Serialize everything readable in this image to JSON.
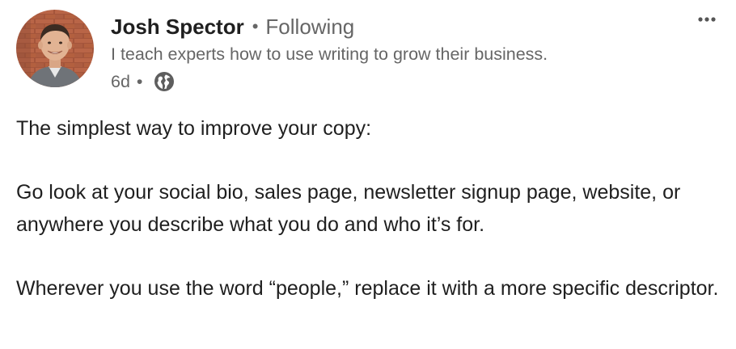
{
  "author": {
    "name": "Josh Spector",
    "follow_status": "Following",
    "headline": "I teach experts how to use writing to grow their business.",
    "separator": "•"
  },
  "meta": {
    "time_ago": "6d",
    "separator": "•",
    "visibility_icon": "globe-icon"
  },
  "menu": {
    "icon": "more-horizontal-icon"
  },
  "post": {
    "paragraphs": [
      "The simplest way to improve your copy:",
      "Go look at your social bio, sales page, newsletter signup page, website, or anywhere you describe what you do and who it’s for.",
      "Wherever you use the word “people,” replace it with a more specific descriptor."
    ]
  },
  "colors": {
    "primary_text": "#1f1f1f",
    "secondary_text": "#666666",
    "background": "#ffffff"
  }
}
